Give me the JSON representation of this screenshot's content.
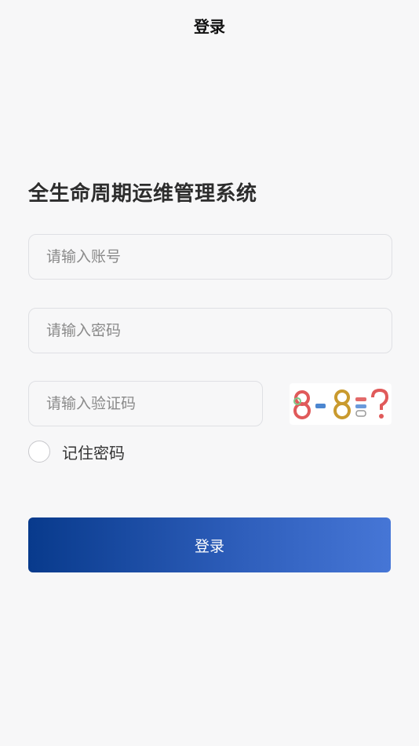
{
  "header": {
    "title": "登录"
  },
  "app": {
    "title": "全生命周期运维管理系统"
  },
  "form": {
    "account_placeholder": "请输入账号",
    "password_placeholder": "请输入密码",
    "captcha_placeholder": "请输入验证码",
    "captcha_text": "8-8=?",
    "remember_label": "记住密码",
    "remember_checked": false,
    "submit_label": "登录"
  },
  "colors": {
    "accent_start": "#083a8c",
    "accent_end": "#4676d6",
    "background": "#f7f7f8"
  }
}
